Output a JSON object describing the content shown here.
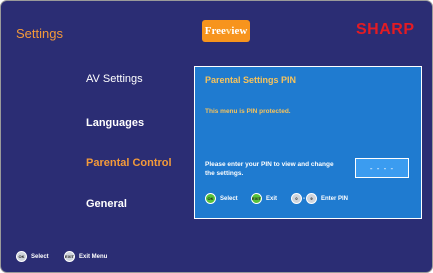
{
  "header": {
    "title": "Settings",
    "freeview_logo": {
      "pre": "Free",
      "dot": "v",
      "post": "iew"
    },
    "brand": "SHARP"
  },
  "menu": {
    "items": [
      {
        "label": "AV Settings",
        "state": "normal"
      },
      {
        "label": "Languages",
        "state": "normal"
      },
      {
        "label": "Parental Control",
        "state": "selected"
      },
      {
        "label": "General",
        "state": "normal"
      }
    ]
  },
  "panel": {
    "title": "Parental Settings PIN",
    "message": "This menu is PIN protected.",
    "prompt": "Please enter your PIN to view and change the settings.",
    "pin_value": "- - - -",
    "legend": {
      "select_icon": "OK",
      "select_label": "Select",
      "exit_icon": "EXIT",
      "exit_label": "Exit",
      "digits_from": "0",
      "digits_to": "9",
      "digits_label": "Enter PIN"
    }
  },
  "footer": {
    "select_icon": "OK",
    "select_label": "Select",
    "exit_icon": "EXIT",
    "exit_label": "Exit Menu"
  },
  "colors": {
    "background": "#2b2d74",
    "accent_orange": "#f39a3a",
    "panel_blue": "#1f7bd0",
    "brand_red": "#e31b23"
  }
}
